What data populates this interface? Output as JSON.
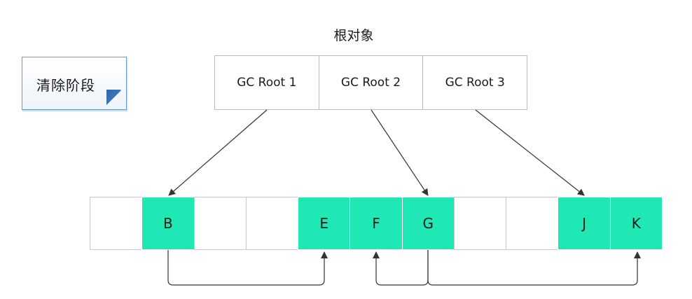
{
  "title": "根对象",
  "phase_label": "清除阶段",
  "gc_roots": [
    "GC Root 1",
    "GC Root 2",
    "GC Root 3"
  ],
  "heap_cells": [
    {
      "label": "",
      "reachable": false
    },
    {
      "label": "B",
      "reachable": true
    },
    {
      "label": "",
      "reachable": false
    },
    {
      "label": "",
      "reachable": false
    },
    {
      "label": "E",
      "reachable": true
    },
    {
      "label": "F",
      "reachable": true
    },
    {
      "label": "G",
      "reachable": true
    },
    {
      "label": "",
      "reachable": false
    },
    {
      "label": "",
      "reachable": false
    },
    {
      "label": "J",
      "reachable": true
    },
    {
      "label": "K",
      "reachable": true
    }
  ],
  "colors": {
    "reachable": "#20e8b4",
    "empty": "#ffffff",
    "border": "#c8c8c8",
    "arrow": "#333333",
    "note_border": "#6a9ac8",
    "note_fold": "#2f66b0"
  },
  "references": [
    {
      "from": "GC Root 1",
      "to": "B"
    },
    {
      "from": "GC Root 2",
      "to": "G"
    },
    {
      "from": "GC Root 3",
      "to": "J"
    },
    {
      "from": "B",
      "to": "E"
    },
    {
      "from": "G",
      "to": "F"
    },
    {
      "from": "G",
      "to": "K"
    }
  ]
}
